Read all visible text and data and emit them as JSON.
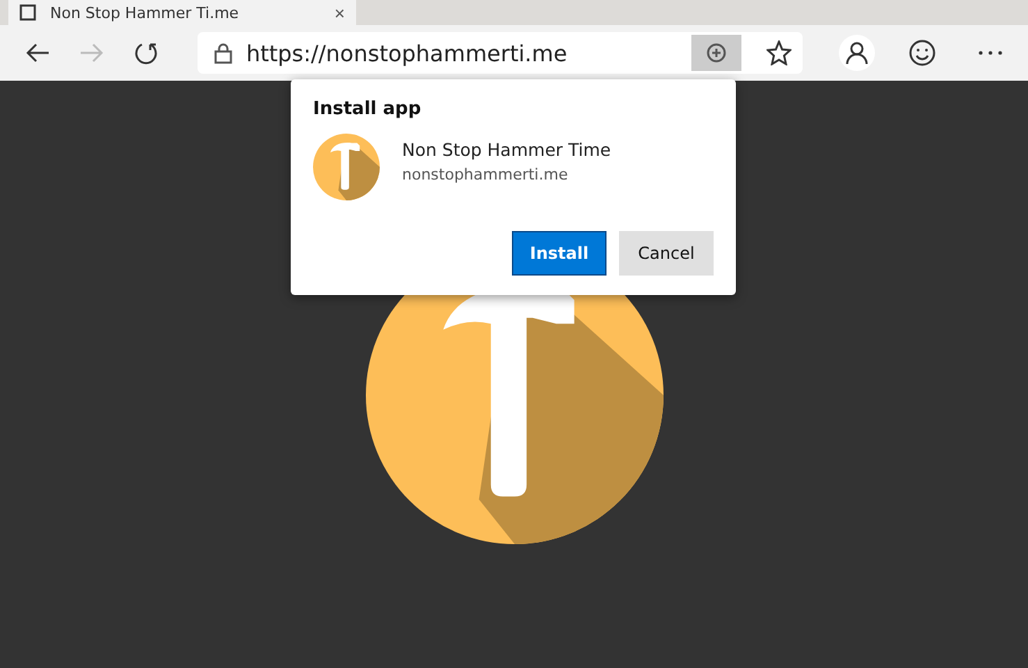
{
  "tab": {
    "title": "Non Stop Hammer Ti.me",
    "close": "×"
  },
  "address_bar": {
    "url": "https://nonstophammerti.me"
  },
  "install_dialog": {
    "title": "Install app",
    "app_name": "Non Stop Hammer Time",
    "app_domain": "nonstophammerti.me",
    "buttons": [
      {
        "label": "Install",
        "kind": "primary"
      },
      {
        "label": "Cancel",
        "kind": "secondary"
      }
    ]
  }
}
